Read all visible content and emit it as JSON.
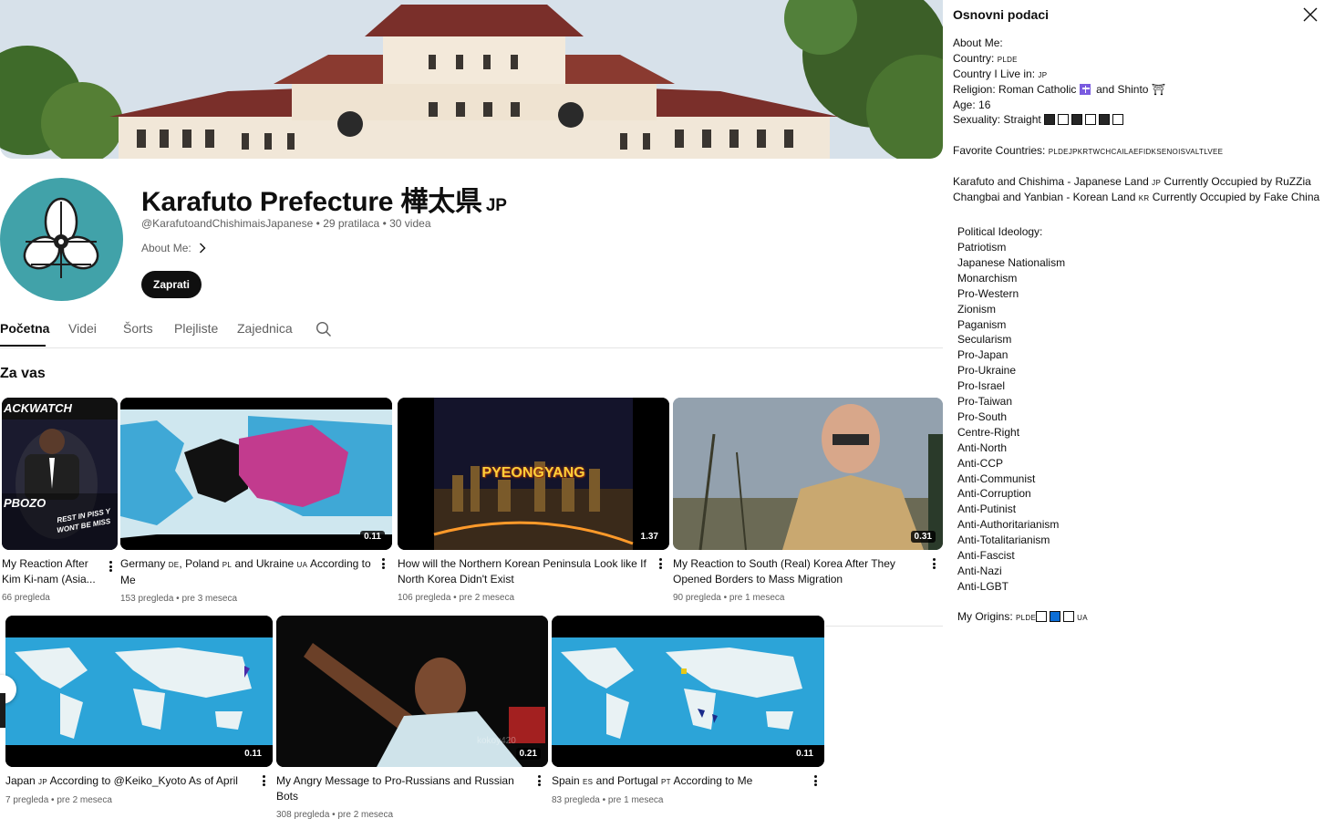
{
  "channel": {
    "name": "Karafuto Prefecture 樺太県",
    "flag_code": "JP",
    "handle": "@KarafutoandChishimaisJapanese",
    "subscribers": "29 pratilaca",
    "videos_count": "30 videa",
    "about_label": "About Me:",
    "subscribe_label": "Zaprati"
  },
  "tabs": [
    {
      "label": "Početna",
      "active": true
    },
    {
      "label": "Videi"
    },
    {
      "label": "Šorts"
    },
    {
      "label": "Plejliste"
    },
    {
      "label": "Zajednica"
    }
  ],
  "section_title": "Za vas",
  "videos": [
    {
      "title_parts": [
        "My Reaction After Kim Ki-nam (Asia..."
      ],
      "views": "66 pregleda",
      "ago": "",
      "duration": "",
      "thumb_text": [
        "ACKWATCH",
        "PBOZO",
        "REST IN PISS Y",
        "WONT BE MISS"
      ]
    },
    {
      "title_parts": [
        "Germany ",
        "DE",
        ", Poland ",
        "PL",
        " and Ukraine ",
        "UA",
        " According to Me"
      ],
      "views": "153 pregleda",
      "ago": "pre 3 meseca",
      "duration": "0.11"
    },
    {
      "title_parts": [
        "How will the Northern Korean Peninsula Look like If North Korea Didn't Exist"
      ],
      "views": "106 pregleda",
      "ago": "pre 2 meseca",
      "duration": "1.37",
      "thumb_text": [
        "PYEONGYANG"
      ]
    },
    {
      "title_parts": [
        "My Reaction to South (Real) Korea After They Opened Borders to Mass Migration"
      ],
      "views": "90 pregleda",
      "ago": "pre 1 meseca",
      "duration": "0.31"
    },
    {
      "title_parts": [
        "Japan ",
        "JP",
        " According to @Keiko_Kyoto As of April"
      ],
      "views": "7 pregleda",
      "ago": "pre 2 meseca",
      "duration": "0.11"
    },
    {
      "title_parts": [
        "My Angry Message to Pro-Russians and Russian Bots"
      ],
      "views": "308 pregleda",
      "ago": "pre 2 meseca",
      "duration": "0.21",
      "thumb_text": [
        "kokoy420"
      ]
    },
    {
      "title_parts": [
        "Spain ",
        "ES",
        " and Portugal ",
        "PT",
        " According to Me"
      ],
      "views": "83 pregleda",
      "ago": "pre 1 meseca",
      "duration": "0.11"
    }
  ],
  "separator": "•",
  "about_panel": {
    "title": "Osnovni podaci",
    "about_me": "About Me:",
    "country_label": "Country:",
    "country_codes": "PLDE",
    "live_label": "Country I Live in:",
    "live_code": "JP",
    "religion_label": "Religion: Roman Catholic",
    "religion_and": "and Shinto",
    "shinto_glyph": "⛩",
    "age": "Age: 16",
    "sexuality_label": "Sexuality: Straight",
    "favorite_label": "Favorite Countries:",
    "favorite_codes": "PLDEJPKRTWCHCAILAEFIDKSENOISVALTLVEE",
    "occupied": [
      [
        "Karafuto and Chishima - Japanese Land ",
        "JP",
        " Currently Occupied by RuZZia"
      ],
      [
        "Changbai and Yanbian - Korean Land ",
        "KR",
        " Currently Occupied by Fake China"
      ]
    ],
    "ideology_label": "Political Ideology:",
    "ideologies": [
      "Patriotism",
      "Japanese Nationalism",
      "Monarchism",
      "Pro-Western",
      "Zionism",
      "Paganism",
      "Secularism",
      "Pro-Japan",
      "Pro-Ukraine",
      "Pro-Israel",
      "Pro-Taiwan",
      "Pro-South",
      "Centre-Right",
      "Anti-North",
      "Anti-CCP",
      "Anti-Communist",
      "Anti-Corruption",
      "Anti-Putinist",
      "Anti-Authoritarianism",
      "Anti-Totalitarianism",
      "Anti-Fascist",
      "Anti-Nazi",
      "Anti-LGBT"
    ],
    "origins_label": "My Origins:",
    "origins_prefix": "PLDE",
    "origins_suffix": "UA"
  }
}
